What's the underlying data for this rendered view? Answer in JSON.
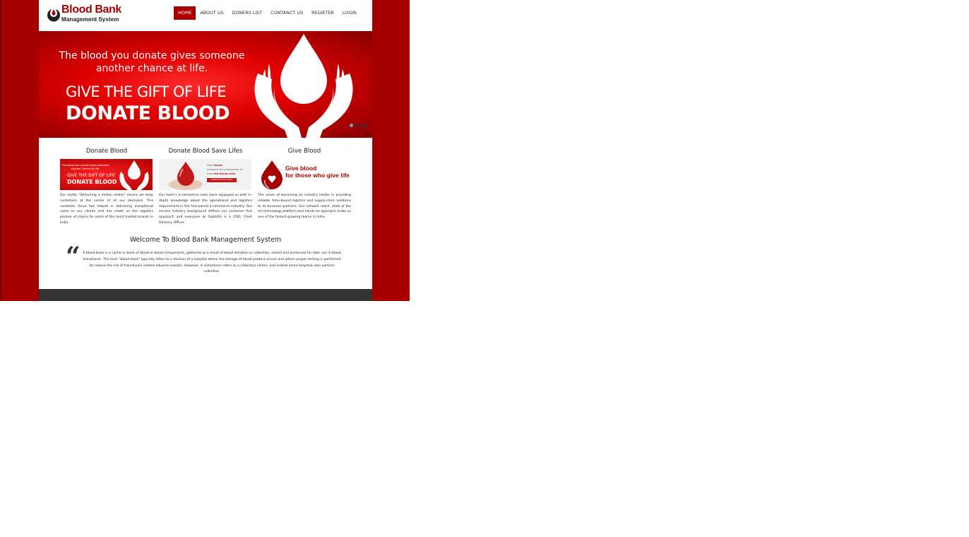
{
  "brand": {
    "name_line1": "Blood Bank",
    "name_line2": "Management System"
  },
  "nav": [
    {
      "label": "HOME",
      "active": true
    },
    {
      "label": "ABOUT US",
      "active": false
    },
    {
      "label": "DONERS LIST",
      "active": false
    },
    {
      "label": "CONTANCT US",
      "active": false
    },
    {
      "label": "REGIETER",
      "active": false
    },
    {
      "label": "LOGIN",
      "active": false
    }
  ],
  "banner": {
    "line1": "The blood you donate gives someone",
    "line2": "another chance at life.",
    "line3": "GIVE THE GIFT OF LIFE",
    "line4": "DONATE BLOOD",
    "slides": 3,
    "active_slide": 1
  },
  "features": [
    {
      "title": "Donate Blood",
      "thumb": {
        "line1": "The blood you donate gives someone",
        "line2": "another chance at life.",
        "line3": "GIVE THE GIFT OF LIFE",
        "line4": "DONATE BLOOD"
      },
      "text": "Our motto \"Delivering a million smiles\" means we keep customers at the center of all our decisions. This customer focus has helped in delivering exceptional value to our clients and has made us the logistics partner of choice for some of the most trusted brands in India."
    },
    {
      "title": "Donate Blood Save Lifes",
      "thumb": {
        "line1": "Give",
        "line1b": "blood",
        "line2": "enhance the production of",
        "line3": "new",
        "line3b": "red blood cells",
        "button": "DONATE BLOOD TODAY"
      },
      "text": "Our team's e-commerce roots have equipped us with in-depth knowledge about the operational and logistics requirement in the fast-paced e-commerce industry. Our service industry background defines our customer first approach and everyone at GoJaVAS is a CDO, Chief Delivery Officer."
    },
    {
      "title": "Give Blood",
      "thumb": {
        "line1": "Give blood",
        "line2": "for those who give life"
      },
      "text": "The vision of becoming an industry leader in providing reliable, time-bound logistics and supply-chain solutions to its business partners. Our network reach, state of the art technology platform and hands-on approach make us one of the fastest growing teams in India."
    }
  ],
  "welcome": {
    "title": "Welcome To Blood Bank Management System",
    "quote_mark": "“",
    "text": "A blood bank is a cache or bank of blood or blood components, gathered as a result of blood donation or collection, stored and preserved for later use in blood transfusion. The term \"blood bank\" typically refers to a division of a hospital where the storage of blood product occurs and where proper testing is performed (to reduce the risk of transfusion related adverse events). However, it sometimes refers to a collection center, and indeed some hospitals also perform collection."
  },
  "colors": {
    "brand_red": "#a70000",
    "banner_red": "#e00000",
    "footer": "#333333",
    "slider_active_dot": "#5aa9d6"
  }
}
